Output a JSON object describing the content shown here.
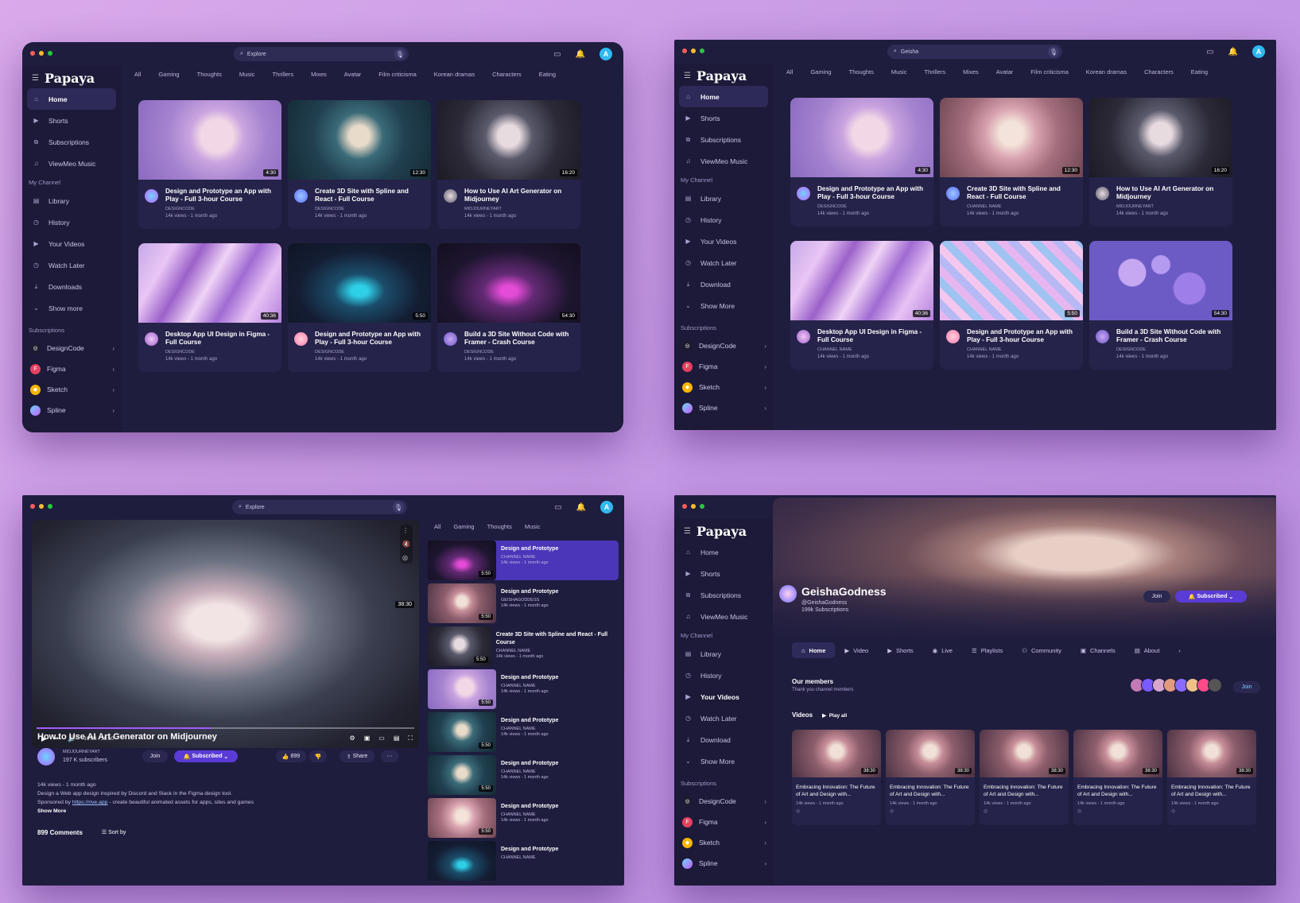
{
  "app": {
    "logo": "Papaya",
    "avatar_letter": "A"
  },
  "searches": {
    "w1": "Explore",
    "w2": "Geisha",
    "w3": "Explore",
    "w4": "Geisha"
  },
  "sidebar": {
    "items": [
      "Home",
      "Shorts",
      "Subscriptions",
      "ViewMeo Music"
    ],
    "section_channel": "My Channel",
    "channel_items_w1": [
      "Library",
      "History",
      "Your Videos",
      "Watch Later",
      "Downloads",
      "Show more"
    ],
    "channel_items_w2": [
      "Library",
      "History",
      "Your Videos",
      "Watch Later",
      "Download",
      "Show More"
    ],
    "section_subs": "Subscriptions",
    "subs": [
      "DesignCode",
      "Figma",
      "Sketch",
      "Spline"
    ]
  },
  "chips": [
    "All",
    "Gaming",
    "Thoughts",
    "Music",
    "Thrillers",
    "Mixes",
    "Avatar",
    "Film criticisma",
    "Korean dramas",
    "Characters",
    "Eating"
  ],
  "w1_cards": [
    {
      "title": "Design and Prototype an App with Play - Full 3-hour Course",
      "channel": "DESIGNCODE",
      "views": "14k views - 1 month ago",
      "duration": "4:30",
      "thumb": "th-lav"
    },
    {
      "title": "Create 3D Site with Spline and React - Full Course",
      "channel": "DESIGNCODE",
      "views": "14k views - 1 month ago",
      "duration": "12:30",
      "thumb": "th-teal"
    },
    {
      "title": "How to Use AI Art Generator on Midjourney",
      "channel": "MIDJOURNEYART",
      "views": "14k views - 1 month ago",
      "duration": "16:20",
      "thumb": "th-dark"
    },
    {
      "title": "Desktop App UI Design in Figma - Full Course",
      "channel": "DESIGNCODE",
      "views": "14k views - 1 month ago",
      "duration": "40:36",
      "thumb": "th-marble"
    },
    {
      "title": "Design and Prototype an App with Play - Full 3-hour Course",
      "channel": "DESIGNCODE",
      "views": "14k views - 1 month ago",
      "duration": "5:50",
      "thumb": "th-bike1"
    },
    {
      "title": "Build a 3D Site Without Code with Framer - Crash Course",
      "channel": "DESIGNCODE",
      "views": "14k views - 1 month ago",
      "duration": "54:30",
      "thumb": "th-bike2"
    }
  ],
  "w2_cards": [
    {
      "title": "Design and Prototype an App with Play - Full 3-hour Course",
      "channel": "DESIGNCODE",
      "views": "14k views - 1 month ago",
      "duration": "4:30",
      "thumb": "th-lav"
    },
    {
      "title": "Create 3D Site with Spline and React - Full Course",
      "channel": "CHANNEL NAME",
      "views": "14k views - 1 month ago",
      "duration": "12:30",
      "thumb": "th-geisha"
    },
    {
      "title": "How to Use AI Art Generator on Midjourney",
      "channel": "MIDJOURNEYART",
      "views": "14k views - 1 month ago",
      "duration": "16:20",
      "thumb": "th-dark"
    },
    {
      "title": "Desktop App UI Design in Figma - Full Course",
      "channel": "CHANNEL NAME",
      "views": "14k views - 1 month ago",
      "duration": "40:36",
      "thumb": "th-marble"
    },
    {
      "title": "Design and Prototype an App with Play - Full 3-hour Course",
      "channel": "CHANNEL NAME",
      "views": "14k views - 1 month ago",
      "duration": "5:50",
      "thumb": "th-cubes"
    },
    {
      "title": "Build a 3D Site Without Code with Framer - Crash Course",
      "channel": "DESIGNCODE",
      "views": "14k views - 1 month ago",
      "duration": "54:30",
      "thumb": "th-flowers"
    }
  ],
  "player": {
    "title": "How to Use AI Art Generator on Midjourney",
    "duration": "38:30",
    "time": "19:08 / 38:30",
    "progress": 0.46,
    "channel": "MIDJOURNEYART",
    "subscribers": "197 K subscribers",
    "join": "Join",
    "subscribed": "Subscribed",
    "likes": "899",
    "share": "Share",
    "more": "···",
    "desc_line1": "14k views - 1 month ago",
    "desc_line2": "Design a Web app design inspired by Discord and Slack in the Figma design tool.",
    "desc_line3_pre": "Sponsored by ",
    "desc_link": "https://rive.app",
    "desc_line3_post": " - create beautiful animated assets for apps, sites and games",
    "show_more": "Show More",
    "comments": "899 Comments",
    "sort": "Sort by"
  },
  "upnext_chips": [
    "All",
    "Gaming",
    "Thoughts",
    "Music"
  ],
  "upnext": [
    {
      "title": "Design and Prototype",
      "channel": "CHANNEL NAME",
      "views": "14k views - 1 month ago",
      "duration": "5:50",
      "thumb": "th-bike2"
    },
    {
      "title": "Design and Prototype",
      "channel": "GEISHAGODDESS",
      "views": "14k views - 1 month ago",
      "duration": "5:50",
      "thumb": "th-sakura"
    },
    {
      "title": "Create 3D Site with Spline and React - Full Course",
      "channel": "CHANNEL NAME",
      "views": "14k views - 1 month ago",
      "duration": "5:50",
      "thumb": "th-dark"
    },
    {
      "title": "Design and Prototype",
      "channel": "CHANNEL NAME",
      "views": "14k views - 1 month ago",
      "duration": "5:50",
      "thumb": "th-lav"
    },
    {
      "title": "Design and Prototype",
      "channel": "CHANNEL NAME",
      "views": "14k views - 1 month ago",
      "duration": "5:50",
      "thumb": "th-teal"
    },
    {
      "title": "Design and Prototype",
      "channel": "CHANNEL NAME",
      "views": "14k views - 1 month ago",
      "duration": "5:50",
      "thumb": "th-teal"
    },
    {
      "title": "Design and Prototype",
      "channel": "CHANNEL NAME",
      "views": "14k views - 1 month ago",
      "duration": "5:50",
      "thumb": "th-geisha"
    },
    {
      "title": "Design and Prototype",
      "channel": "CHANNEL NAME",
      "views": "",
      "duration": "",
      "thumb": "th-bike1"
    }
  ],
  "channel": {
    "name": "GeishaGodness",
    "handle": "@GeishaGodness",
    "subs": "199k Subscriptions",
    "join": "Join",
    "subscribed": "Subscribed",
    "tabs": [
      "Home",
      "Video",
      "Shorts",
      "Live",
      "Playlists",
      "Community",
      "Channels",
      "About"
    ],
    "members_title": "Our members",
    "members_sub": "Thank you channel members",
    "members_join": "Join",
    "videos": "Videos",
    "play_all": "Play all",
    "video_title": "Embracing Innovation: The Future of Art and Design with...",
    "video_views": "14k views - 1 month ago",
    "video_duration": "38:30"
  }
}
